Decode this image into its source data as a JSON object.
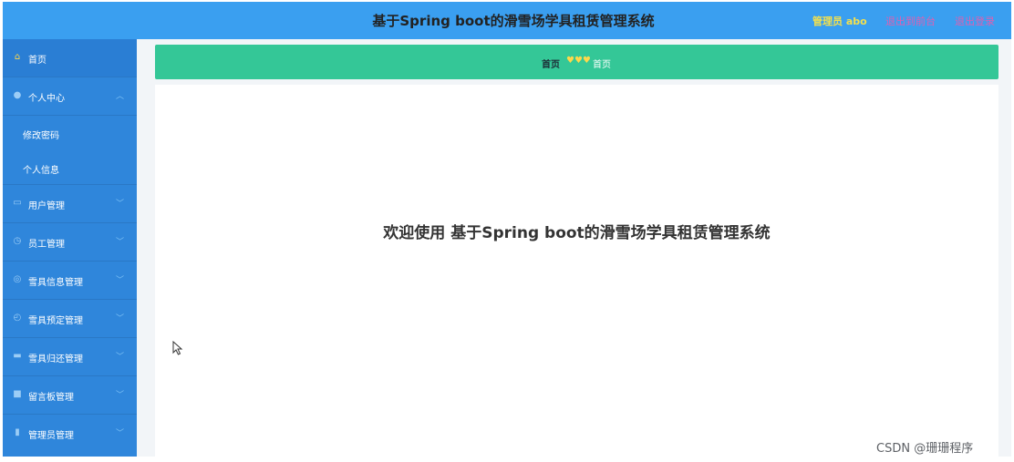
{
  "header": {
    "title": "基于Spring boot的滑雪场学具租赁管理系统",
    "admin_label": "管理员 abo",
    "links": [
      "退出到前台",
      "退出登录"
    ]
  },
  "sidebar": {
    "items": [
      {
        "label": "首页",
        "icon": "home-icon"
      },
      {
        "label": "个人中心",
        "icon": "user-icon"
      },
      {
        "label": "修改密码"
      },
      {
        "label": "个人信息"
      },
      {
        "label": "用户管理",
        "icon": "chat-icon"
      },
      {
        "label": "员工管理",
        "icon": "clock-icon"
      },
      {
        "label": "雪具信息管理",
        "icon": "globe-icon"
      },
      {
        "label": "雪具预定管理",
        "icon": "time-icon"
      },
      {
        "label": "雪具归还管理",
        "icon": "box-icon"
      },
      {
        "label": "留言板管理",
        "icon": "board-icon"
      },
      {
        "label": "管理员管理",
        "icon": "lock-icon"
      }
    ]
  },
  "breadcrumb": {
    "home": "首页",
    "separator": "♥♥♥",
    "current": "首页"
  },
  "main": {
    "welcome": "欢迎使用 基于Spring boot的滑雪场学具租赁管理系统"
  },
  "watermark": "CSDN @珊珊程序",
  "colors": {
    "topbar": "#3a9ff0",
    "sidebar": "#2f86db",
    "breadcrumb": "#34c797",
    "admin_label": "#f4e04d",
    "links": "#e05fb0"
  }
}
